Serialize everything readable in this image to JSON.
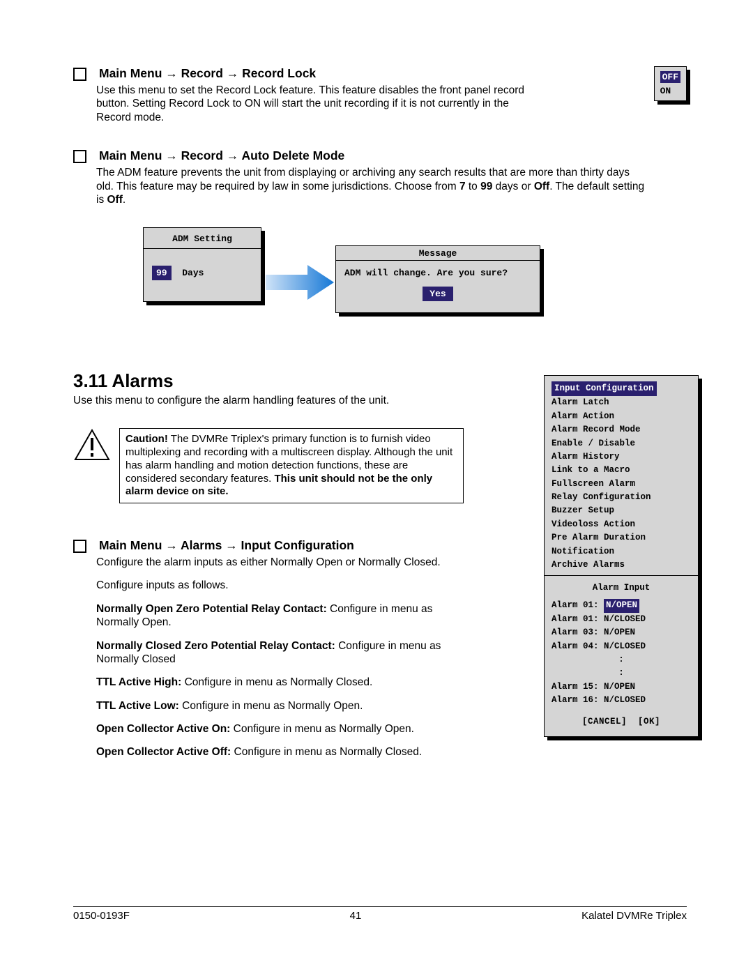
{
  "sec_record_lock": {
    "title": "Main Menu → Record → Record Lock",
    "body": "Use this menu to set the Record Lock feature. This feature disables the front panel record button. Setting Record Lock to ON will start the unit recording if it is not currently in the Record mode."
  },
  "onoff_box": {
    "off": "OFF",
    "on": "ON"
  },
  "sec_adm": {
    "title": "Main Menu → Record → Auto Delete Mode",
    "body_pre": "The ADM feature prevents the unit from displaying or archiving any search results that are more than thirty days old. This feature may be required by law in some jurisdictions.  Choose from ",
    "b7": "7",
    "mid1": " to ",
    "b99": "99",
    "mid2": " days or ",
    "boff": "Off",
    "mid3": ". The default setting is ",
    "boff2": "Off",
    "end": "."
  },
  "adm_setting": {
    "title": "ADM Setting",
    "value": "99",
    "days": "Days"
  },
  "message_box": {
    "title": "Message",
    "line": "ADM will change. Are you sure?",
    "yes": "Yes"
  },
  "alarms_section": {
    "heading": "3.11 Alarms",
    "intro": "Use this menu to configure the alarm handling features of the unit."
  },
  "caution": {
    "lead": "Caution!",
    "body1": "  The DVMRe Triplex's primary function is to furnish video multiplexing and recording with a multiscreen display. Although the unit has alarm handling and motion detection functions, these are considered secondary features.  ",
    "bold2": "This unit should not be the only alarm device on site."
  },
  "alarm_menu": {
    "items": [
      "Input Configuration",
      "Alarm Latch",
      "Alarm Action",
      "Alarm Record Mode",
      "Enable / Disable",
      "Alarm History",
      "Link to a Macro",
      "Fullscreen Alarm",
      "Relay Configuration",
      "Buzzer Setup",
      "Videoloss Action",
      "Pre Alarm Duration",
      "Notification",
      "Archive Alarms"
    ]
  },
  "sec_input_cfg": {
    "title": "Main Menu → Alarms → Input Configuration",
    "p1": "Configure the alarm inputs as either Normally Open or Normally Closed.",
    "p2": "Configure inputs as follows.",
    "no_lead": "Normally Open Zero Potential Relay Contact:",
    "no_body": "  Configure in menu as Normally Open.",
    "nc_lead": "Normally Closed Zero Potential Relay Contact:",
    "nc_body": "  Configure in menu as Normally Closed",
    "tah_lead": "TTL Active High:",
    "tah_body": "  Configure in menu as Normally Closed.",
    "tal_lead": "TTL Active Low:",
    "tal_body": "  Configure in menu as Normally Open.",
    "ocon_lead": "Open Collector Active On:",
    "ocon_body": "  Configure in menu as Normally Open.",
    "ocoff_lead": "Open Collector Active Off:",
    "ocoff_body": "  Configure in menu as Normally Closed."
  },
  "alarm_input_box": {
    "title": "Alarm Input",
    "rows": [
      {
        "label": "Alarm 01:",
        "val": "N/OPEN",
        "hl": true
      },
      {
        "label": "Alarm 01:",
        "val": "N/CLOSED",
        "hl": false
      },
      {
        "label": "Alarm 03:",
        "val": "N/OPEN",
        "hl": false
      },
      {
        "label": "Alarm 04:",
        "val": "N/CLOSED",
        "hl": false
      }
    ],
    "dots": ":",
    "rows2": [
      {
        "label": "Alarm 15:",
        "val": "N/OPEN"
      },
      {
        "label": "Alarm 16:",
        "val": "N/CLOSED"
      }
    ],
    "cancel": "[CANCEL]",
    "ok": "[OK]"
  },
  "footer": {
    "left": "0150-0193F",
    "center": "41",
    "right": "Kalatel DVMRe Triplex"
  }
}
